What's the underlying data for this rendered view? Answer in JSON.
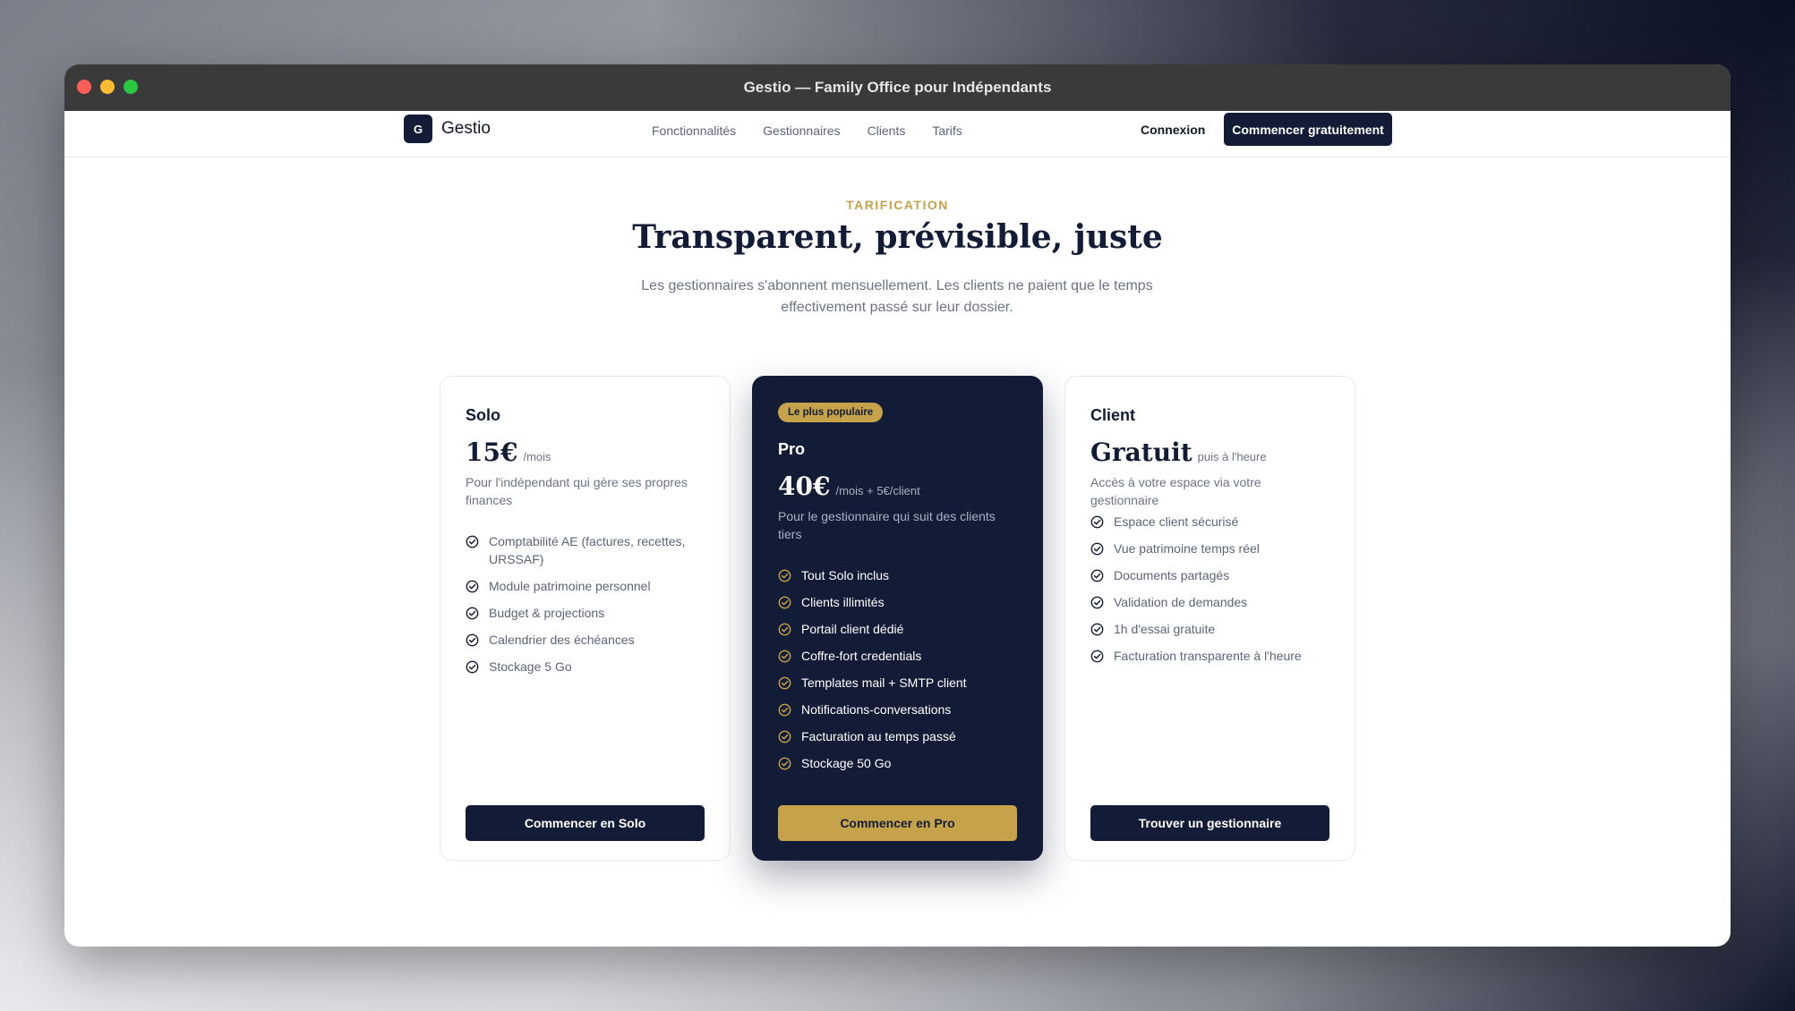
{
  "window": {
    "title": "Gestio — Family Office pour Indépendants"
  },
  "nav": {
    "logo_letter": "G",
    "brand": "Gestio",
    "links": [
      "Fonctionnalités",
      "Gestionnaires",
      "Clients",
      "Tarifs"
    ],
    "login": "Connexion",
    "cta": "Commencer gratuitement"
  },
  "hero": {
    "eyebrow": "TARIFICATION",
    "title": "Transparent, prévisible, juste",
    "subtitle": "Les gestionnaires s'abonnent mensuellement. Les clients ne paient que le temps effectivement passé sur leur dossier."
  },
  "plans": [
    {
      "name": "Solo",
      "price": "15€",
      "price_suffix": "/mois",
      "description": "Pour l'indépendant qui gère ses propres finances",
      "features": [
        "Comptabilité AE (factures, recettes, URSSAF)",
        "Module patrimoine personnel",
        "Budget & projections",
        "Calendrier des échéances",
        "Stockage 5 Go"
      ],
      "button": "Commencer en Solo"
    },
    {
      "badge": "Le plus populaire",
      "name": "Pro",
      "price": "40€",
      "price_suffix": "/mois + 5€/client",
      "description": "Pour le gestionnaire qui suit des clients tiers",
      "features": [
        "Tout Solo inclus",
        "Clients illimités",
        "Portail client dédié",
        "Coffre-fort credentials",
        "Templates mail + SMTP client",
        "Notifications-conversations",
        "Facturation au temps passé",
        "Stockage 50 Go"
      ],
      "button": "Commencer en Pro"
    },
    {
      "name": "Client",
      "price": "Gratuit",
      "price_suffix": "puis à l'heure",
      "description": "Accès à votre espace via votre gestionnaire",
      "features": [
        "Espace client sécurisé",
        "Vue patrimoine temps réel",
        "Documents partagés",
        "Validation de demandes",
        "1h d'essai gratuite",
        "Facturation transparente à l'heure"
      ],
      "button": "Trouver un gestionnaire"
    }
  ],
  "colors": {
    "navy": "#131c36",
    "gold": "#c6a24a",
    "muted_text": "#6b7386"
  }
}
